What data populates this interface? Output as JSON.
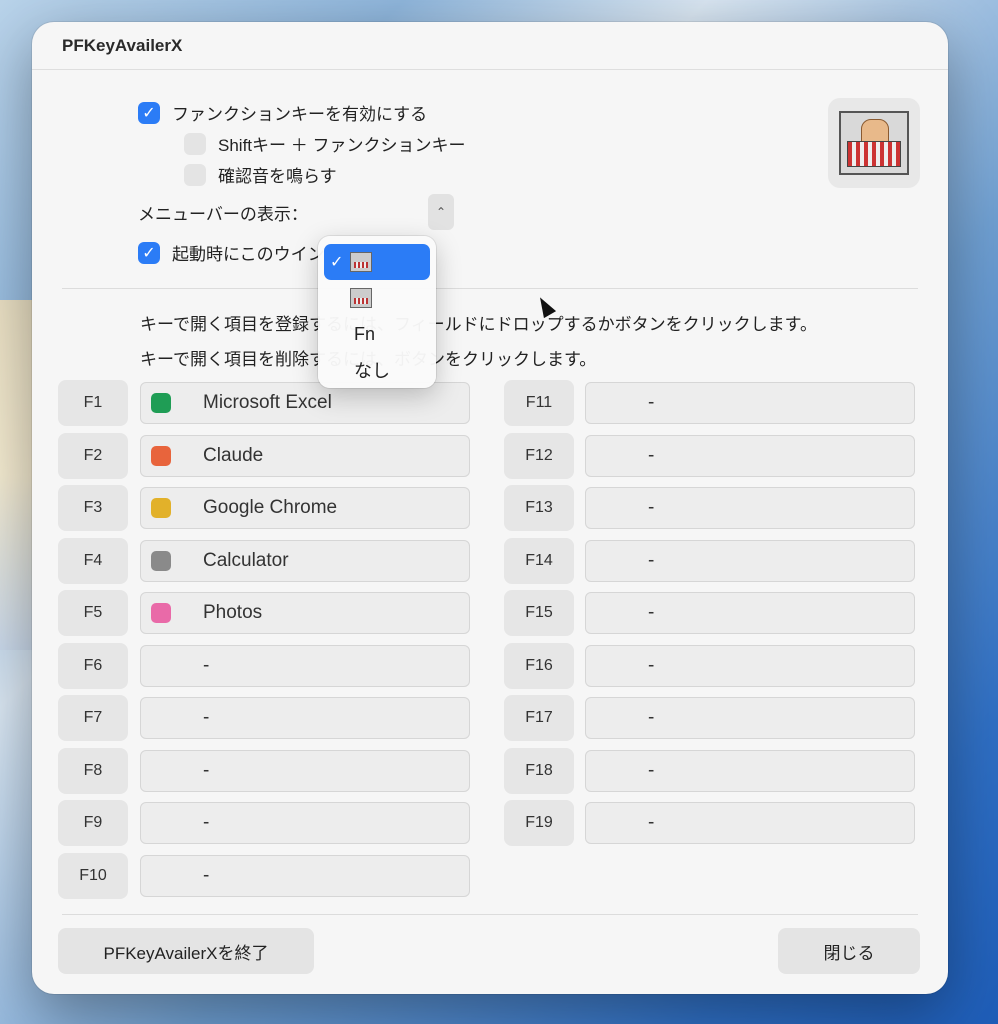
{
  "window": {
    "title": "PFKeyAvailerX"
  },
  "settings": {
    "enable_fkeys": {
      "label": "ファンクションキーを有効にする",
      "checked": true
    },
    "shift_fkeys": {
      "label": "Shiftキー ＋ ファンクションキー",
      "checked": false
    },
    "confirm_sound": {
      "label": "確認音を鳴らす",
      "checked": false
    },
    "menubar_label": "メニューバーの表示：",
    "show_on_launch": {
      "label": "起動時にこのウインドウを表示",
      "checked": true
    }
  },
  "menubar_dropdown": {
    "options": [
      {
        "type": "icon",
        "icon": "keyboard-icon",
        "selected": true
      },
      {
        "type": "icon",
        "icon": "keyboard-icon",
        "selected": false
      },
      {
        "type": "text",
        "label": "Fn",
        "selected": false
      },
      {
        "type": "text",
        "label": "なし",
        "selected": false
      }
    ]
  },
  "instructions": {
    "line1": "キーで開く項目を登録するには、フィールドにドロップするかボタンをクリックします。",
    "line2": "キーで開く項目を削除するには、ボタンをクリックします。"
  },
  "keys_left": [
    {
      "key": "F1",
      "value": "Microsoft Excel",
      "icon": "excel-icon",
      "color": "#1f9d55"
    },
    {
      "key": "F2",
      "value": "Claude",
      "icon": "claude-icon",
      "color": "#e8643c"
    },
    {
      "key": "F3",
      "value": "Google Chrome",
      "icon": "chrome-icon",
      "color": "#e2b12a"
    },
    {
      "key": "F4",
      "value": "Calculator",
      "icon": "calculator-icon",
      "color": "#8a8a8a"
    },
    {
      "key": "F5",
      "value": "Photos",
      "icon": "photos-icon",
      "color": "#e96aa8"
    },
    {
      "key": "F6",
      "value": "-"
    },
    {
      "key": "F7",
      "value": "-"
    },
    {
      "key": "F8",
      "value": "-"
    },
    {
      "key": "F9",
      "value": "-"
    },
    {
      "key": "F10",
      "value": "-"
    }
  ],
  "keys_right": [
    {
      "key": "F11",
      "value": "-"
    },
    {
      "key": "F12",
      "value": "-"
    },
    {
      "key": "F13",
      "value": "-"
    },
    {
      "key": "F14",
      "value": "-"
    },
    {
      "key": "F15",
      "value": "-"
    },
    {
      "key": "F16",
      "value": "-"
    },
    {
      "key": "F17",
      "value": "-"
    },
    {
      "key": "F18",
      "value": "-"
    },
    {
      "key": "F19",
      "value": "-"
    }
  ],
  "buttons": {
    "quit": "PFKeyAvailerXを終了",
    "close": "閉じる"
  },
  "colors": {
    "accent": "#2b7cf6"
  }
}
